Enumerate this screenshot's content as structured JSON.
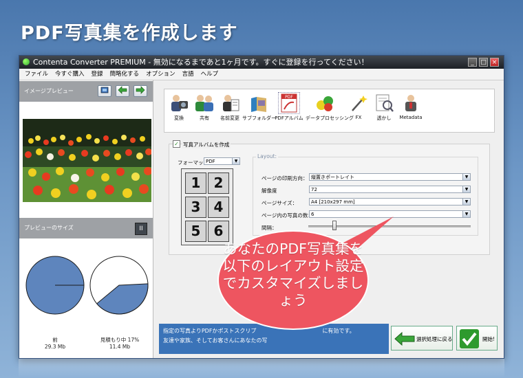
{
  "headline": "PDF写真集を作成します",
  "window": {
    "title": "Contenta Converter PREMIUM - 無効になるまであと1ヶ月です。すぐに登録を行ってください！",
    "min": "_",
    "max": "□",
    "close": "×"
  },
  "menu": [
    "ファイル",
    "今すぐ購入",
    "登録",
    "簡略化する",
    "オプション",
    "言語",
    "ヘルプ"
  ],
  "left_panel": {
    "preview_title": "イメージプレビュー",
    "size_title": "プレビューのサイズ",
    "pause_label": "II",
    "before_label": "前",
    "before_size": "29.3 Mb",
    "estimate_label": "見積もり中 17%",
    "estimate_size": "11.4 Mb",
    "estimate_fraction": 0.17,
    "pie_color": "#5e85bd"
  },
  "toolbar": [
    {
      "label": "変換",
      "icon": "convert-icon"
    },
    {
      "label": "共有",
      "icon": "share-icon"
    },
    {
      "label": "名前変更",
      "icon": "rename-icon"
    },
    {
      "label": "サブフォルダー",
      "icon": "subfolder-icon"
    },
    {
      "label": "PDFアルバム",
      "icon": "pdf-album-icon"
    },
    {
      "label": "データプロセッシング",
      "icon": "data-processing-icon"
    },
    {
      "label": "FX",
      "icon": "fx-icon"
    },
    {
      "label": "透かし",
      "icon": "watermark-icon"
    },
    {
      "label": "Metadata",
      "icon": "metadata-icon"
    }
  ],
  "album": {
    "checkbox_label": "写真アルバムを作成",
    "checked": true,
    "format_label": "フォーマット：",
    "format_value": "PDF",
    "grid_numbers": [
      "1",
      "2",
      "3",
      "4",
      "5",
      "6"
    ],
    "layout_title": "Layout:",
    "fields": [
      {
        "label": "ページの印刷方向：",
        "value": "縦置きポートレイト"
      },
      {
        "label": "解像度",
        "value": "72"
      },
      {
        "label": "ページサイズ：",
        "value": "A4 [210x297 mm]"
      },
      {
        "label": "ページ内の写真の数：",
        "value": "6"
      }
    ],
    "spacing_label": "間隔：",
    "spacing_value": 0.16
  },
  "info_text_1": "指定の写真よりPDFかポストスクリプ",
  "info_text_1b": "に有効です。",
  "info_text_2": "友達や家族、そしてお客さんにあなたの写",
  "back_button": "選択処理に戻る",
  "start_button": "開始!",
  "bubble_text": "あなたのPDF写真集を以下のレイアウト設定でカスタマイズしましょう",
  "colors": {
    "info_bg": "#3a73b8",
    "bubble": "#ee5560"
  }
}
